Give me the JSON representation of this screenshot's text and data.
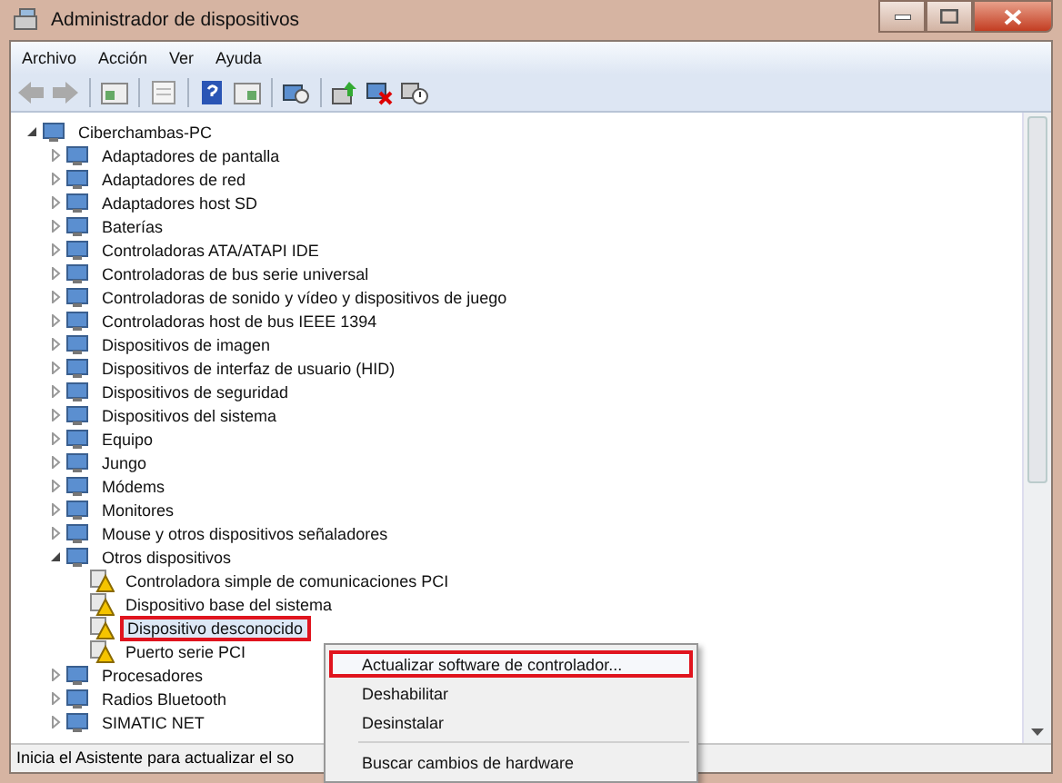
{
  "window": {
    "title": "Administrador de dispositivos"
  },
  "menu_bar": [
    "Archivo",
    "Acción",
    "Ver",
    "Ayuda"
  ],
  "tree": [
    {
      "label": "Ciberchambas-PC",
      "expanded": true,
      "selected": false,
      "callout": false,
      "children": [
        {
          "label": "Adaptadores de pantalla",
          "expanded": false,
          "selected": false,
          "callout": false
        },
        {
          "label": "Adaptadores de red",
          "expanded": false,
          "selected": false,
          "callout": false
        },
        {
          "label": "Adaptadores host SD",
          "expanded": false,
          "selected": false,
          "callout": false
        },
        {
          "label": "Baterías",
          "expanded": false,
          "selected": false,
          "callout": false
        },
        {
          "label": "Controladoras ATA/ATAPI IDE",
          "expanded": false,
          "selected": false,
          "callout": false
        },
        {
          "label": "Controladoras de bus serie universal",
          "expanded": false,
          "selected": false,
          "callout": false
        },
        {
          "label": "Controladoras de sonido y vídeo y dispositivos de juego",
          "expanded": false,
          "selected": false,
          "callout": false
        },
        {
          "label": "Controladoras host de bus IEEE 1394",
          "expanded": false,
          "selected": false,
          "callout": false
        },
        {
          "label": "Dispositivos de imagen",
          "expanded": false,
          "selected": false,
          "callout": false
        },
        {
          "label": "Dispositivos de interfaz de usuario (HID)",
          "expanded": false,
          "selected": false,
          "callout": false
        },
        {
          "label": "Dispositivos de seguridad",
          "expanded": false,
          "selected": false,
          "callout": false
        },
        {
          "label": "Dispositivos del sistema",
          "expanded": false,
          "selected": false,
          "callout": false
        },
        {
          "label": "Equipo",
          "expanded": false,
          "selected": false,
          "callout": false
        },
        {
          "label": "Jungo",
          "expanded": false,
          "selected": false,
          "callout": false
        },
        {
          "label": "Módems",
          "expanded": false,
          "selected": false,
          "callout": false
        },
        {
          "label": "Monitores",
          "expanded": false,
          "selected": false,
          "callout": false
        },
        {
          "label": "Mouse y otros dispositivos señaladores",
          "expanded": false,
          "selected": false,
          "callout": false
        },
        {
          "label": "Otros dispositivos",
          "expanded": true,
          "selected": false,
          "callout": false,
          "children": [
            {
              "label": "Controladora simple de comunicaciones PCI",
              "warning": true,
              "selected": false,
              "callout": false
            },
            {
              "label": "Dispositivo base del sistema",
              "warning": true,
              "selected": false,
              "callout": false
            },
            {
              "label": "Dispositivo desconocido",
              "warning": true,
              "selected": true,
              "callout": true
            },
            {
              "label": "Puerto serie PCI",
              "warning": true,
              "selected": false,
              "callout": false
            }
          ]
        },
        {
          "label": "Procesadores",
          "expanded": false,
          "selected": false,
          "callout": false
        },
        {
          "label": "Radios Bluetooth",
          "expanded": false,
          "selected": false,
          "callout": false
        },
        {
          "label": "SIMATIC NET",
          "expanded": false,
          "selected": false,
          "callout": false
        }
      ]
    }
  ],
  "context_menu": {
    "groups": [
      [
        {
          "label": "Actualizar software de controlador...",
          "callout": true
        },
        {
          "label": "Deshabilitar",
          "callout": false
        },
        {
          "label": "Desinstalar",
          "callout": false
        }
      ],
      [
        {
          "label": "Buscar cambios de hardware",
          "callout": false
        }
      ]
    ]
  },
  "status_bar": {
    "text": "Inicia el Asistente para actualizar el so"
  }
}
